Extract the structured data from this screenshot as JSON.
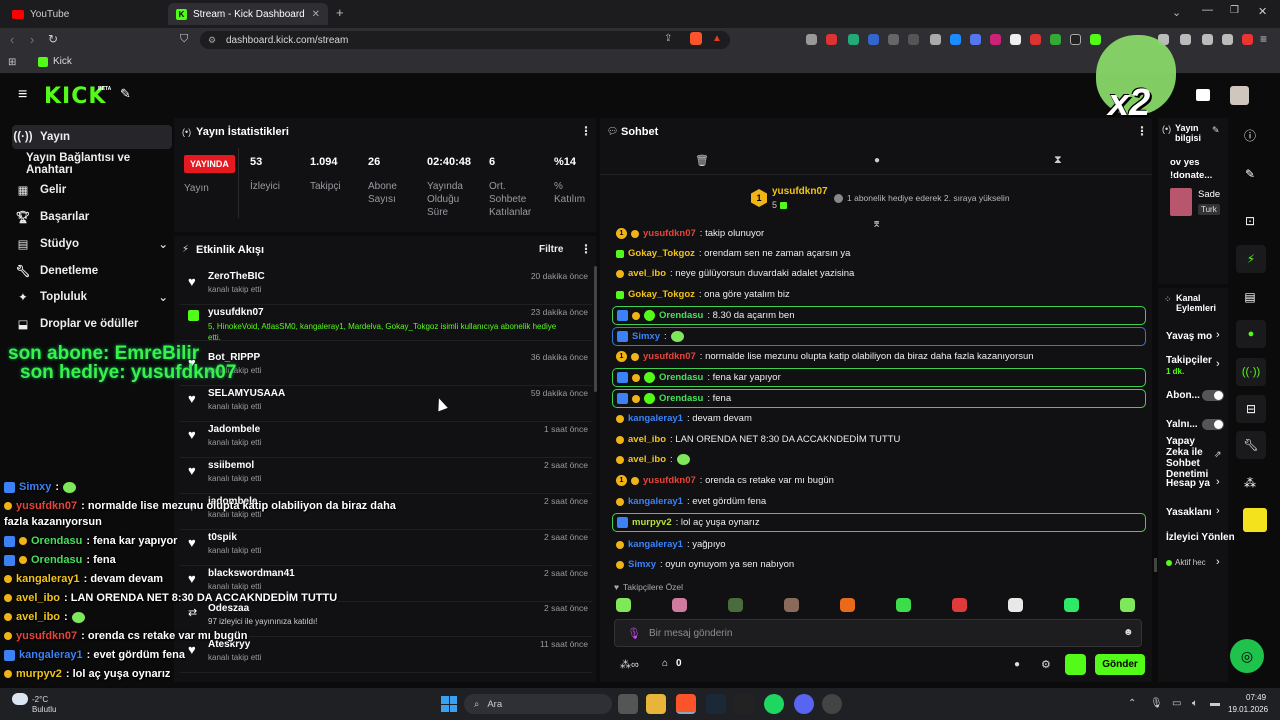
{
  "browser": {
    "tabs": [
      {
        "label": "YouTube",
        "icon": "youtube-icon"
      },
      {
        "label": "Stream - Kick Dashboard",
        "icon": "kick-icon",
        "active": true
      }
    ],
    "url": "dashboard.kick.com/stream",
    "bookmark": "Kick"
  },
  "kick": {
    "logo": "KICK",
    "beta": "BETA"
  },
  "sidebar": {
    "items": [
      {
        "label": "Yayın",
        "icon": "broadcast-icon",
        "selected": true
      },
      {
        "label": "Yayın Bağlantısı ve Anahtarı",
        "icon": ""
      },
      {
        "label": "Gelir",
        "icon": "revenue-icon"
      },
      {
        "label": "Başarılar",
        "icon": "trophy-icon"
      },
      {
        "label": "Stüdyo",
        "icon": "studio-icon"
      },
      {
        "label": "Denetleme",
        "icon": "wrench-icon"
      },
      {
        "label": "Topluluk",
        "icon": "community-icon"
      },
      {
        "label": "Droplar ve ödüller",
        "icon": "drops-icon"
      }
    ]
  },
  "stats": {
    "title": "Yayın İstatistikleri",
    "live_badge": "YAYINDA",
    "live_label": "Yayın",
    "items": [
      {
        "value": "53",
        "label": "İzleyici"
      },
      {
        "value": "1.094",
        "label": "Takipçi"
      },
      {
        "value": "26",
        "label": "Abone Sayısı"
      },
      {
        "value": "02:40:48",
        "label": "Yayında Olduğu Süre"
      },
      {
        "value": "6",
        "label": "Ort. Sohbete Katılanlar"
      },
      {
        "value": "%14",
        "label": "% Katılım"
      }
    ]
  },
  "activity": {
    "title": "Etkinlik Akışı",
    "filter": "Filtre",
    "events": [
      {
        "name": "ZeroTheBIC",
        "sub": "kanalı takip etti",
        "time": "20 dakika önce",
        "icon": "heart-icon"
      },
      {
        "name": "yusufdkn07",
        "sub": "5, HinokeVoid, AtlasSM0, kangaleray1, Mardelva, Gokay_Tokgoz isimli kullanıcıya abonelik hediye etti.",
        "time": "23 dakika önce",
        "icon": "gift-icon"
      },
      {
        "name": "Bot_RIPPP",
        "sub": "kanalı takip etti",
        "time": "36 dakika önce",
        "icon": "heart-icon"
      },
      {
        "name": "SELAMYUSAAA",
        "sub": "kanalı takip etti",
        "time": "59 dakika önce",
        "icon": "heart-icon"
      },
      {
        "name": "Jadombele",
        "sub": "kanalı takip etti",
        "time": "1 saat önce",
        "icon": "heart-icon"
      },
      {
        "name": "ssiibemol",
        "sub": "kanalı takip etti",
        "time": "2 saat önce",
        "icon": "heart-icon"
      },
      {
        "name": "jadombele",
        "sub": "kanalı takip etti",
        "time": "2 saat önce",
        "icon": "heart-icon"
      },
      {
        "name": "t0spik",
        "sub": "kanalı takip etti",
        "time": "2 saat önce",
        "icon": "heart-icon"
      },
      {
        "name": "blackswordman41",
        "sub": "kanalı takip etti",
        "time": "2 saat önce",
        "icon": "heart-icon"
      },
      {
        "name": "Odeszaa",
        "sub": "97 izleyici ile yayınınıza katıldı!",
        "time": "2 saat önce",
        "icon": "raid-icon"
      },
      {
        "name": "Ateskryy",
        "sub": "kanalı takip etti",
        "time": "11 saat önce",
        "icon": "heart-icon"
      }
    ]
  },
  "chat": {
    "title": "Sohbet",
    "gifter_name": "yusufdkn07",
    "gifter_count": "5",
    "gifter_rank": "1",
    "gifter_note": "1 abonelik hediye ederek 2. sıraya yükselin",
    "messages": [
      {
        "user": "yusufdkn07",
        "color": "red",
        "text": ": takip olunuyor",
        "box": ""
      },
      {
        "user": "Gokay_Tokgoz",
        "color": "yel",
        "text": ": orendam sen ne zaman açarsın ya",
        "box": ""
      },
      {
        "user": "avel_ibo",
        "color": "yel",
        "text": ": neye gülüyorsun duvardaki adalet yazisina",
        "box": ""
      },
      {
        "user": "Gokay_Tokgoz",
        "color": "yel",
        "text": ": ona göre yatalım biz",
        "box": ""
      },
      {
        "user": "Orendasu",
        "color": "grn",
        "text": ": 8.30 da açarım ben",
        "box": "green"
      },
      {
        "user": "Simxy",
        "color": "blu",
        "text": ":",
        "box": "blue",
        "emote": true
      },
      {
        "user": "yusufdkn07",
        "color": "red",
        "text": ": normalde lise mezunu olupta katip olabiliyon da biraz daha fazla kazanıyorsun",
        "box": ""
      },
      {
        "user": "Orendasu",
        "color": "grn",
        "text": ": fena kar yapıyor",
        "box": "green"
      },
      {
        "user": "Orendasu",
        "color": "grn",
        "text": ": fena",
        "box": "green"
      },
      {
        "user": "kangaleray1",
        "color": "blu",
        "text": ": devam devam",
        "box": ""
      },
      {
        "user": "avel_ibo",
        "color": "yel",
        "text": ": LAN ORENDA NET 8:30 DA ACCAKNDEDİM TUTTU",
        "box": ""
      },
      {
        "user": "avel_ibo",
        "color": "yel",
        "text": ":",
        "box": "",
        "emote": true
      },
      {
        "user": "yusufdkn07",
        "color": "red",
        "text": ": orenda cs retake var mı bugün",
        "box": ""
      },
      {
        "user": "kangaleray1",
        "color": "blu",
        "text": ": evet gördüm fena",
        "box": ""
      },
      {
        "user": "murpyv2",
        "color": "lg",
        "text": ": lol aç yuşa oynarız",
        "box": "green"
      },
      {
        "user": "kangaleray1",
        "color": "blu",
        "text": ": yağpıyo",
        "box": ""
      },
      {
        "user": "Simxy",
        "color": "blu",
        "text": ": oyun oynuyom ya sen nabıyon",
        "box": ""
      }
    ],
    "followers_only": "Takipçilere Özel",
    "placeholder": "Bir mesaj gönderin",
    "points": "0",
    "send": "Gönder"
  },
  "overlay": {
    "line1": "son abone: EmreBilir",
    "line2": "son hediye: yusufdkn07",
    "multiplier": "x2",
    "chat": [
      {
        "user": "Simxy",
        "color": "blu",
        "text": ":"
      },
      {
        "user": "yusufdkn07",
        "color": "red",
        "text": ": normalde lise mezunu olupta katip olabiliyon da biraz daha"
      },
      {
        "user": "",
        "color": "wht",
        "text": "fazla kazanıyorsun"
      },
      {
        "user": "Orendasu",
        "color": "grn",
        "text": ": fena kar yapıyor"
      },
      {
        "user": "Orendasu",
        "color": "grn",
        "text": ": fena"
      },
      {
        "user": "kangaleray1",
        "color": "yel",
        "text": ": devam devam"
      },
      {
        "user": "avel_ibo",
        "color": "yel",
        "text": ": LAN ORENDA NET 8:30 DA ACCAKNDEDİM TUTTU"
      },
      {
        "user": "avel_ibo",
        "color": "yel",
        "text": ":"
      },
      {
        "user": "yusufdkn07",
        "color": "red",
        "text": ": orenda cs retake var mı bugün"
      },
      {
        "user": "kangaleray1",
        "color": "blu",
        "text": ": evet gördüm fena"
      },
      {
        "user": "murpyv2",
        "color": "yel",
        "text": ": lol aç yuşa oynarız"
      },
      {
        "user": "kangaleray1",
        "color": "blu",
        "text": ": yağpıyo"
      },
      {
        "user": "Simxy",
        "color": "blu",
        "text": ": oyun oynuyom ya sen nabıyon"
      }
    ]
  },
  "right": {
    "stream_info": "Yayın bilgisi",
    "title_snip1": "ov yes",
    "title_snip2": "!donate...",
    "cat1": "Sade",
    "cat2": "Turk",
    "channel_actions": "Kanal Eylemleri",
    "slow": "Yavaş mo",
    "followers": "Takipçiler",
    "followers_sub": "1 dk.",
    "abone": "Abon...",
    "yalniz": "Yalnı...",
    "ai": "Yapay Zeka ile Sohbet Denetimi",
    "hesap": "Hesap ya",
    "yasaklanan": "Yasaklanı",
    "izleyici": "İzleyici Yönlen",
    "aktif": "Aktif hec"
  },
  "taskbar": {
    "search": "Ara",
    "time": "07:49",
    "date": "19.01.2026",
    "weather_temp": "-2°C",
    "weather_desc": "Bulutlu"
  }
}
